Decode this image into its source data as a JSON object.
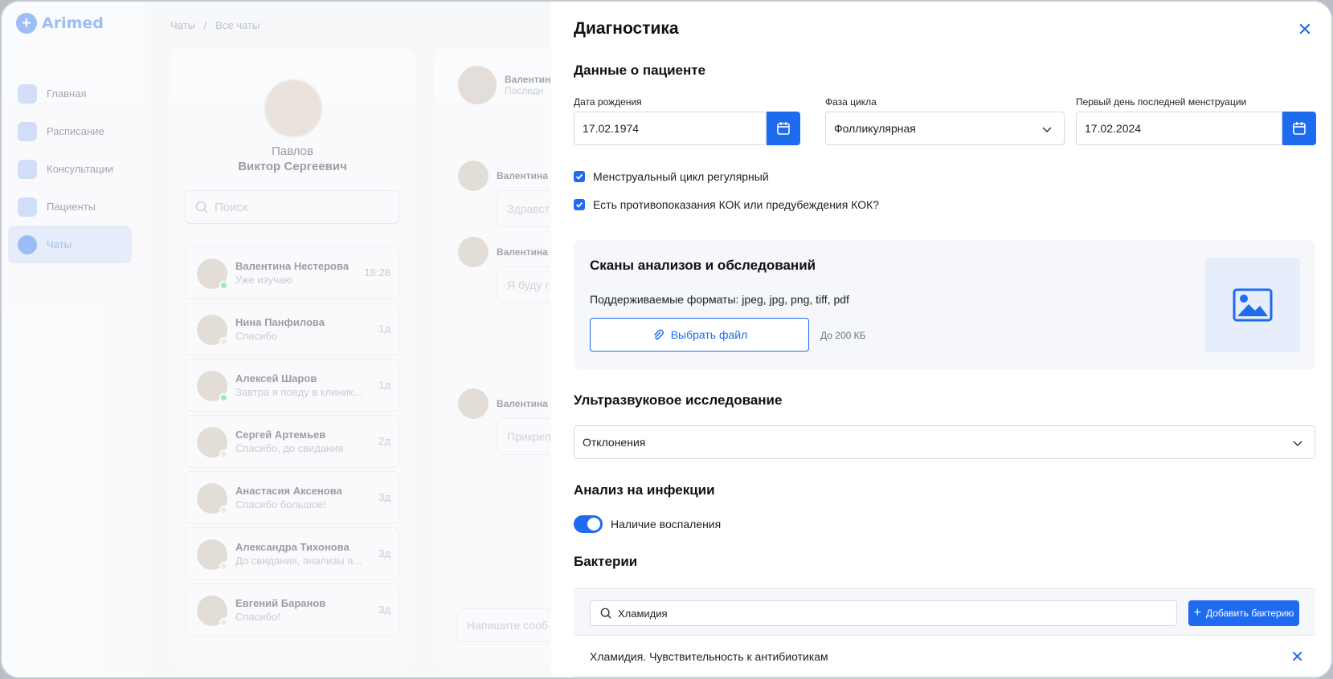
{
  "app": {
    "name": "Arimed"
  },
  "nav": [
    {
      "label": "Главная"
    },
    {
      "label": "Расписание"
    },
    {
      "label": "Консультации"
    },
    {
      "label": "Пациенты"
    },
    {
      "label": "Чаты",
      "active": true
    }
  ],
  "breadcrumb": {
    "root": "Чаты",
    "sep": "/",
    "current": "Все чаты"
  },
  "doctor": {
    "last": "Павлов",
    "rest": "Виктор Сергеевич"
  },
  "search": {
    "placeholder": "Поиск"
  },
  "chats": [
    {
      "name": "Валентина Нестерова",
      "msg": "Уже изучаю",
      "time": "18:28",
      "online": true
    },
    {
      "name": "Нина Панфилова",
      "msg": "Спасибо",
      "time": "1д",
      "online": false
    },
    {
      "name": "Алексей Шаров",
      "msg": "Завтра я поеду в клинику...",
      "time": "1д",
      "online": true
    },
    {
      "name": "Сергей Артемьев",
      "msg": "Спасибо, до свидания",
      "time": "2д",
      "online": false
    },
    {
      "name": "Анастасия Аксенова",
      "msg": "Спасибо большое!",
      "time": "3д",
      "online": false
    },
    {
      "name": "Александра Тихонова",
      "msg": "До свидания, анализы я...",
      "time": "3д",
      "online": false
    },
    {
      "name": "Евгений Баранов",
      "msg": "Спасибо!",
      "time": "3д",
      "online": false
    }
  ],
  "chat_window": {
    "header_name": "Валентин",
    "header_sub": "Последн",
    "sender": "Валентина",
    "bubbles": [
      "Здравст",
      "Я буду г",
      "Прикреп"
    ],
    "compose_placeholder": "Напишите сооб"
  },
  "panel": {
    "title": "Диагностика",
    "patient_section": "Данные о пациенте",
    "dob": {
      "label": "Дата рождения",
      "value": "17.02.1974"
    },
    "phase": {
      "label": "Фаза цикла",
      "value": "Фолликулярная"
    },
    "lmp": {
      "label": "Первый день последней менструации",
      "value": "17.02.2024"
    },
    "check1": "Менструальный цикл регулярный",
    "check2": "Есть противопоказания КОК или предубеждения КОК?",
    "scans": {
      "title": "Сканы анализов и обследований",
      "formats": "Поддерживаемые форматы: jpeg, jpg, png, tiff, pdf",
      "button": "Выбрать файл",
      "limit": "До 200 КБ"
    },
    "ultrasound": {
      "title": "Ультразвуковое исследование",
      "value": "Отклонения"
    },
    "infections": {
      "title": "Анализ на инфекции",
      "toggle_label": "Наличие воспаления",
      "toggle_on": true
    },
    "bacteria": {
      "title": "Бактерии",
      "search_value": "Хламидия",
      "add_button": "Добавить бактерию",
      "item": "Хламидия. Чувствительность к антибиотикам"
    }
  },
  "colors": {
    "accent": "#1f6bf0"
  }
}
